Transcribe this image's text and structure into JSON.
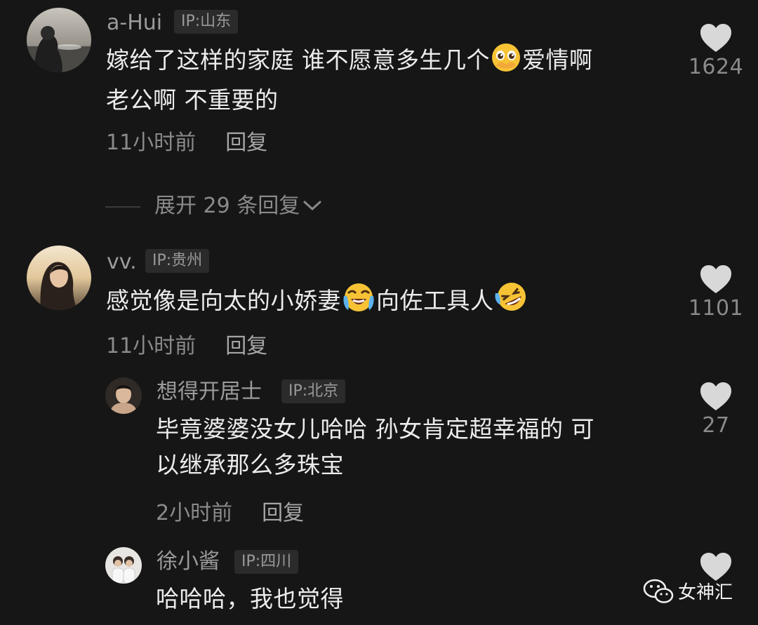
{
  "comments": [
    {
      "username": "a-Hui",
      "ip": "IP:山东",
      "text_line1": "嫁给了这样的家庭 谁不愿意多生几个",
      "text_line1b": "爱情啊",
      "text_line2": "老公啊 不重要的",
      "time": "11小时前",
      "reply": "回复",
      "likes": "1624",
      "expand": "展开 29 条回复"
    },
    {
      "username": "vv.",
      "ip": "IP:贵州",
      "text_a": "感觉像是向太的小娇妻",
      "text_b": "向佐工具人",
      "time": "11小时前",
      "reply": "回复",
      "likes": "1101"
    },
    {
      "username": "想得开居士",
      "ip": "IP:北京",
      "text_line1": "毕竟婆婆没女儿哈哈 孙女肯定超幸福的 可",
      "text_line2": "以继承那么多珠宝",
      "time": "2小时前",
      "reply": "回复",
      "likes": "27"
    },
    {
      "username": "徐小酱",
      "ip": "IP:四川",
      "text": "哈哈哈，我也觉得"
    }
  ],
  "watermark": "女神汇",
  "icons": {
    "like": "heart-icon",
    "expand": "chevron-down-icon",
    "watermark": "wechat-icon",
    "emoji1": "pleading-face-emoji",
    "emoji2": "crying-face-emoji",
    "emoji3": "rolling-laughing-emoji"
  },
  "colors": {
    "background": "#161616",
    "text": "#ececec",
    "muted": "#8a8a8a",
    "heart": "#d8d8d8"
  }
}
